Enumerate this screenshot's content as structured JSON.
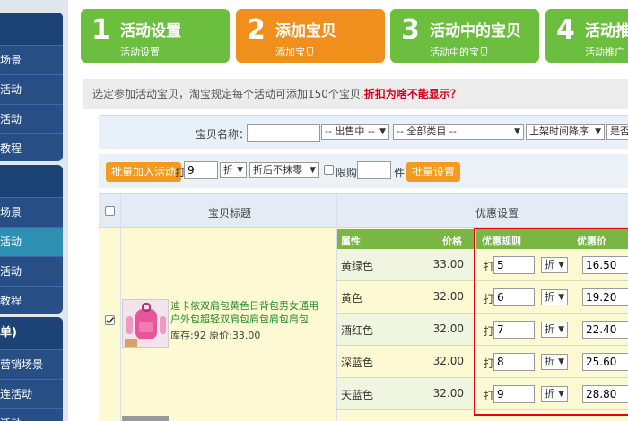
{
  "sidebar": {
    "group1": [
      "场景",
      "活动",
      "活动",
      "教程"
    ],
    "group2": [
      "场景",
      "活动",
      "活动",
      "教程"
    ],
    "group3_title": "单)",
    "group3": [
      "营销场景",
      "连活动",
      "活动"
    ]
  },
  "steps": [
    {
      "num": "1",
      "title": "活动设置",
      "sub": "活动设置"
    },
    {
      "num": "2",
      "title": "添加宝贝",
      "sub": "添加宝贝"
    },
    {
      "num": "3",
      "title": "活动中的宝贝",
      "sub": "活动中的宝贝"
    },
    {
      "num": "4",
      "title": "活动推",
      "sub": "活动推广"
    }
  ],
  "notice": {
    "text": "选定参加活动宝贝，淘宝规定每个活动可添加150个宝贝,",
    "warn": "折扣为啥不能显示？"
  },
  "filter": {
    "name_label": "宝贝名称：",
    "name_value": "",
    "status": "-- 出售中 --",
    "category": "-- 全部类目 --",
    "sort": "上架时间降序",
    "extra": "是否"
  },
  "batch": {
    "add_label": "批量加入活动",
    "discount_prefix": "打",
    "discount_value": "9",
    "unit": "折",
    "rounding": "折后不抹零",
    "limit_label": "限购",
    "limit_value": "",
    "limit_unit": "件",
    "set_label": "批量设置"
  },
  "table": {
    "col_title": "宝贝标题",
    "col_discount": "优惠设置",
    "attr_head": "属性",
    "price_head": "价格",
    "rule_head": "优惠规则",
    "dprice_head": "优惠价"
  },
  "product": {
    "title": "迪卡侬双肩包黄色日背包男女通用户外包超轻双肩包肩包肩包肩包",
    "stock": "库存:92 原价:33.00"
  },
  "rows": [
    {
      "attr": "黄绿色",
      "price": "33.00",
      "prefix": "打",
      "discount": "5",
      "unit": "折",
      "dprice": "16.50"
    },
    {
      "attr": "黄色",
      "price": "32.00",
      "prefix": "打",
      "discount": "6",
      "unit": "折",
      "dprice": "19.20"
    },
    {
      "attr": "酒红色",
      "price": "32.00",
      "prefix": "打",
      "discount": "7",
      "unit": "折",
      "dprice": "22.40"
    },
    {
      "attr": "深蓝色",
      "price": "32.00",
      "prefix": "打",
      "discount": "8",
      "unit": "折",
      "dprice": "25.60"
    },
    {
      "attr": "天蓝色",
      "price": "32.00",
      "prefix": "打",
      "discount": "9",
      "unit": "折",
      "dprice": "28.80"
    }
  ]
}
